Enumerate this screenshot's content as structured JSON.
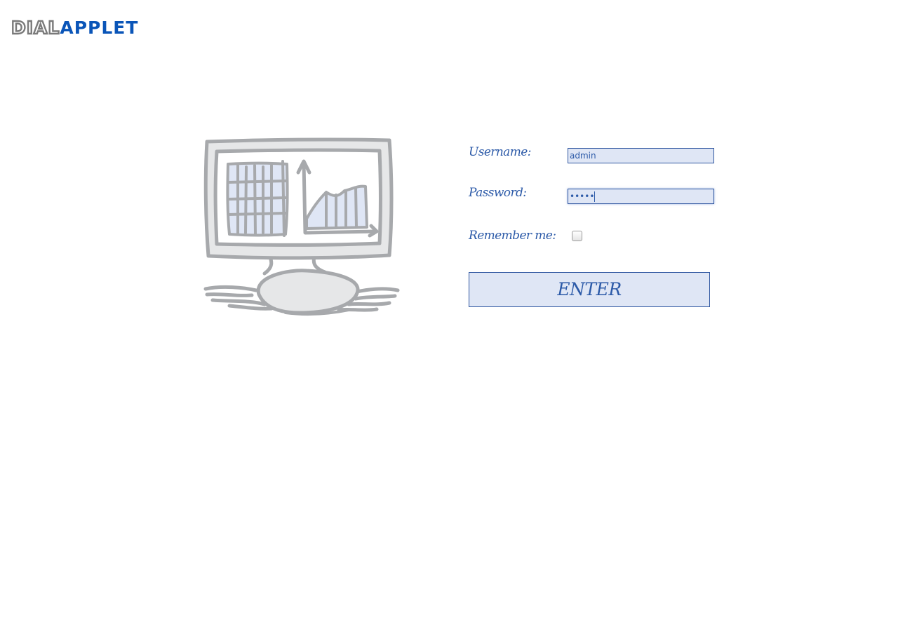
{
  "logo": {
    "part1": "DIAL",
    "part2": "APPLET"
  },
  "illustration": "monitor-chart-icon",
  "login": {
    "username_label": "Username:",
    "username_value": "admin",
    "password_label": "Password:",
    "password_value": "•••••",
    "remember_label": "Remember me:",
    "remember_checked": false,
    "enter_label": "ENTER"
  },
  "colors": {
    "accent": "#2c5aa8",
    "field_background": "#dfe6f5",
    "logo_blue": "#0a55b8",
    "logo_gray": "#7a7a7a",
    "illustration_gray": "#a7a9ac"
  }
}
